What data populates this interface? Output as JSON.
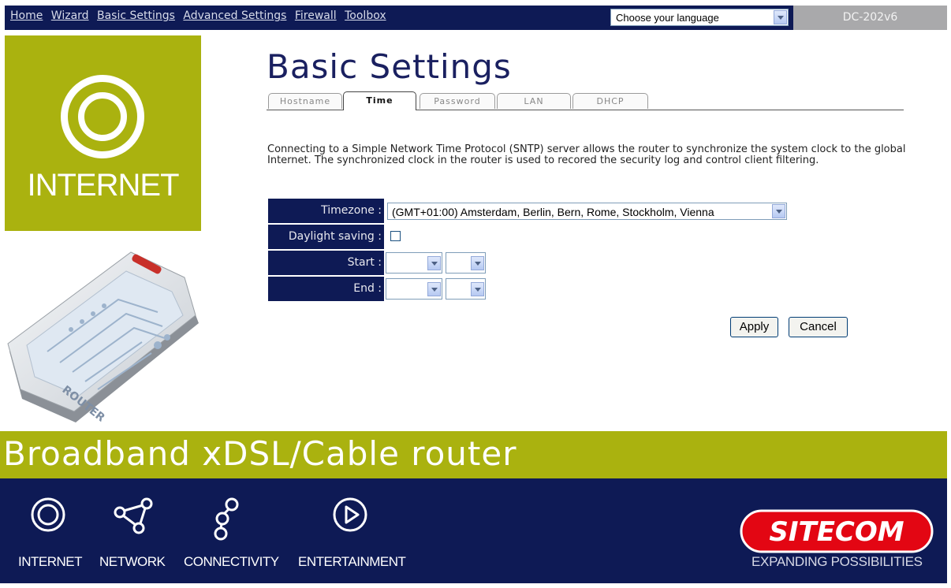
{
  "nav": {
    "links": [
      "Home",
      "Wizard",
      "Basic Settings",
      "Advanced Settings",
      "Firewall",
      "Toolbox"
    ],
    "language_select": "Choose your language",
    "model": "DC-202v6"
  },
  "sidebar": {
    "internet_label": "INTERNET"
  },
  "main": {
    "title": "Basic Settings",
    "tabs": [
      "Hostname",
      "Time",
      "Password",
      "LAN",
      "DHCP"
    ],
    "active_tab": "Time",
    "description": "Connecting to a Simple Network Time Protocol (SNTP) server allows the router to synchronize the system clock to the global Internet. The synchronized clock in the router is used to recored the security log and control client filtering.",
    "form": {
      "timezone_label": "Timezone :",
      "timezone_value": "(GMT+01:00) Amsterdam, Berlin, Bern, Rome, Stockholm, Vienna",
      "daylight_label": "Daylight saving :",
      "daylight_checked": false,
      "start_label": "Start :",
      "start_month": "",
      "start_day": "",
      "end_label": "End :",
      "end_month": "",
      "end_day": ""
    },
    "apply_label": "Apply",
    "cancel_label": "Cancel"
  },
  "banner": {
    "text": "Broadband xDSL/Cable router"
  },
  "footer": {
    "items": [
      "INTERNET",
      "NETWORK",
      "CONNECTIVITY",
      "ENTERTAINMENT"
    ],
    "logo": "SITECOM",
    "tagline": "EXPANDING POSSIBILITIES"
  },
  "colors": {
    "navy": "#0e1a55",
    "olive": "#aab20f",
    "logo_red": "#e30613"
  }
}
